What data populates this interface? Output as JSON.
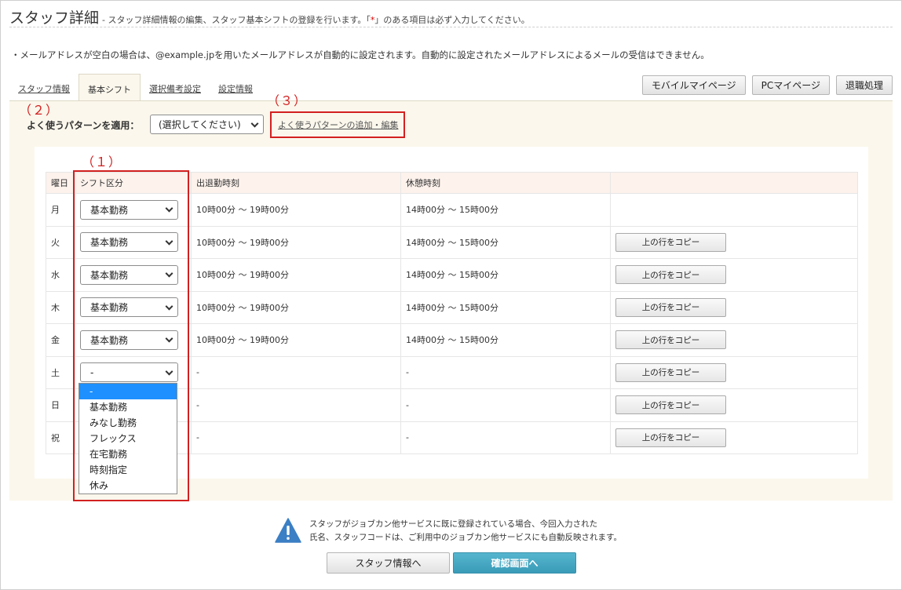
{
  "header": {
    "title": "スタッフ詳細",
    "subtitle_prefix": "- スタッフ詳細情報の編集、スタッフ基本シフトの登録を行います。「",
    "subtitle_required": "*",
    "subtitle_suffix": "」のある項目は必ず入力してください。"
  },
  "notice": "・メールアドレスが空白の場合は、@example.jpを用いたメールアドレスが自動的に設定されます。自動的に設定されたメールアドレスによるメールの受信はできません。",
  "tabs": [
    "スタッフ情報",
    "基本シフト",
    "選択備考設定",
    "設定情報"
  ],
  "top_buttons": [
    "モバイルマイページ",
    "PCマイページ",
    "退職処理"
  ],
  "annotations": [
    "（１）",
    "（２）",
    "（３）"
  ],
  "pattern": {
    "label": "よく使うパターンを適用：",
    "select_value": "(選択してください)",
    "link": "よく使うパターンの追加・編集"
  },
  "table": {
    "headers": [
      "曜日",
      "シフト区分",
      "出退勤時刻",
      "休憩時刻",
      ""
    ],
    "copy_label": "上の行をコピー",
    "rows": [
      {
        "day": "月",
        "type": "基本勤務",
        "work": "10時00分 〜 19時00分",
        "break": "14時00分 〜 15時00分"
      },
      {
        "day": "火",
        "type": "基本勤務",
        "work": "10時00分 〜 19時00分",
        "break": "14時00分 〜 15時00分"
      },
      {
        "day": "水",
        "type": "基本勤務",
        "work": "10時00分 〜 19時00分",
        "break": "14時00分 〜 15時00分"
      },
      {
        "day": "木",
        "type": "基本勤務",
        "work": "10時00分 〜 19時00分",
        "break": "14時00分 〜 15時00分"
      },
      {
        "day": "金",
        "type": "基本勤務",
        "work": "10時00分 〜 19時00分",
        "break": "14時00分 〜 15時00分"
      },
      {
        "day": "土",
        "type": "-",
        "work": "-",
        "break": "-"
      },
      {
        "day": "日",
        "type": "",
        "work": "-",
        "break": "-"
      },
      {
        "day": "祝",
        "type": "",
        "work": "-",
        "break": "-"
      }
    ]
  },
  "dropdown_options": [
    "-",
    "基本勤務",
    "みなし勤務",
    "フレックス",
    "在宅勤務",
    "時刻指定",
    "休み"
  ],
  "warning": {
    "line1": "スタッフがジョブカン他サービスに既に登録されている場合、今回入力された",
    "line2": "氏名、スタッフコードは、ご利用中のジョブカン他サービスにも自動反映されます。"
  },
  "footer_buttons": [
    "スタッフ情報へ",
    "確認画面へ"
  ],
  "colors": {
    "panel_bg": "#fbf7ec",
    "header_bg": "#fdf2ec",
    "annotation_red": "#d32020",
    "primary_blue": "#3a9bb8",
    "dropdown_highlight": "#1e90ff",
    "warning_blue": "#3b7fc4"
  }
}
